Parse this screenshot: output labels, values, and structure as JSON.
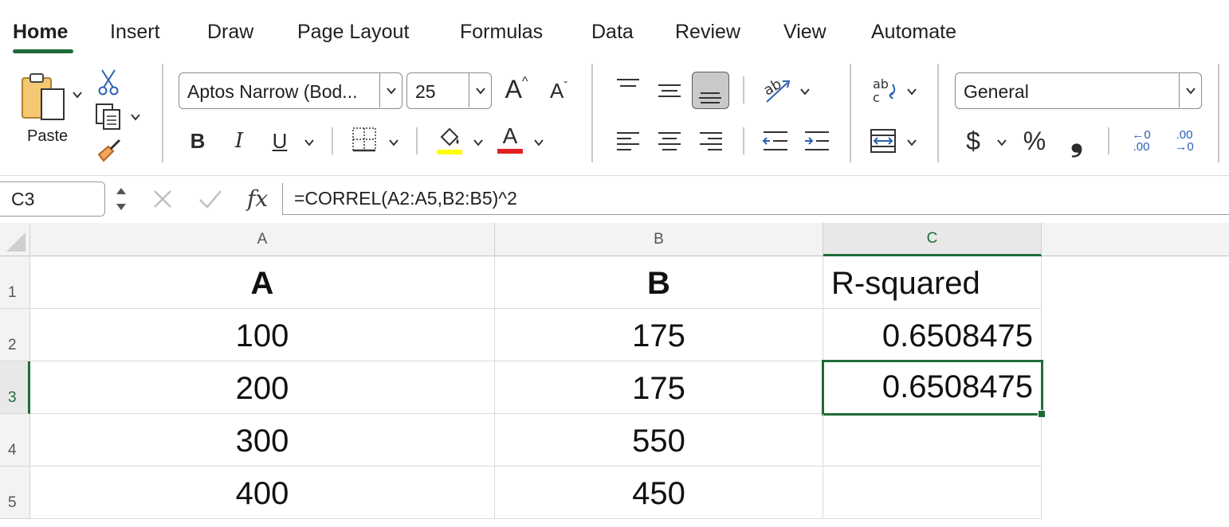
{
  "ribbon_tabs": [
    {
      "label": "Home",
      "active": true
    },
    {
      "label": "Insert"
    },
    {
      "label": "Draw"
    },
    {
      "label": "Page Layout"
    },
    {
      "label": "Formulas"
    },
    {
      "label": "Data"
    },
    {
      "label": "Review"
    },
    {
      "label": "View"
    },
    {
      "label": "Automate"
    }
  ],
  "clipboard": {
    "paste_label": "Paste"
  },
  "font": {
    "name": "Aptos Narrow (Bod...",
    "size": "25",
    "bold_label": "B",
    "italic_label": "I",
    "underline_label": "U",
    "font_color_label": "A",
    "grow_label": "A",
    "shrink_label": "A"
  },
  "colors": {
    "accent": "#1e6b3a",
    "highlight": "#ffff00",
    "font_color": "#e02020"
  },
  "number": {
    "format": "General",
    "currency_label": "$",
    "percent_label": "%",
    "comma_label": "❟",
    "decrease_decimal_label": "←0 .00",
    "increase_decimal_label": ".00 →0"
  },
  "formula_bar": {
    "cell_ref": "C3",
    "fx_label": "fx",
    "formula": "=CORREL(A2:A5,B2:B5)^2"
  },
  "sheet": {
    "columns": [
      "A",
      "B",
      "C"
    ],
    "rows": [
      {
        "n": "1",
        "cells": [
          "A",
          "B",
          "R-squared"
        ]
      },
      {
        "n": "2",
        "cells": [
          "100",
          "175",
          "0.6508475"
        ]
      },
      {
        "n": "3",
        "cells": [
          "200",
          "175",
          "0.6508475"
        ]
      },
      {
        "n": "4",
        "cells": [
          "300",
          "550",
          ""
        ]
      },
      {
        "n": "5",
        "cells": [
          "400",
          "450",
          ""
        ]
      }
    ],
    "active_cell": "C3"
  }
}
